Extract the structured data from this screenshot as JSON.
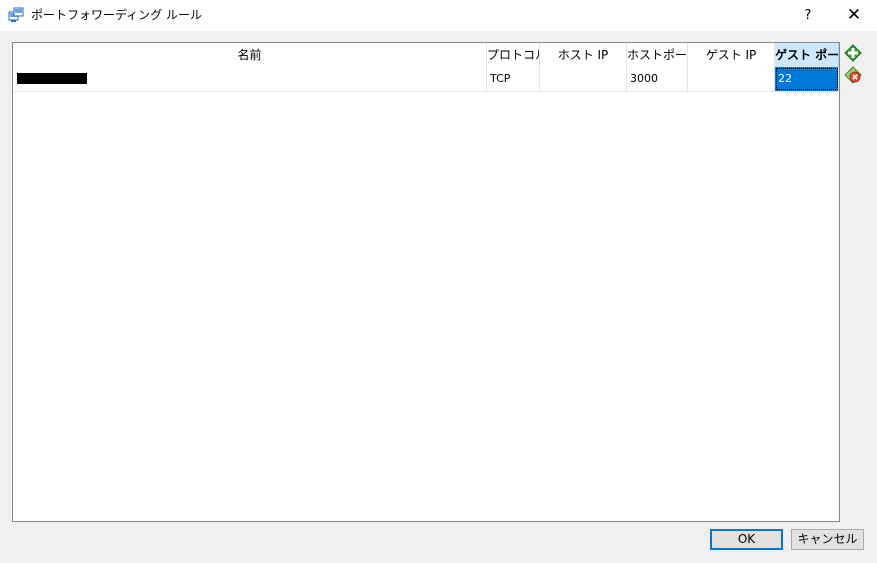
{
  "window": {
    "title": "ポートフォワーディング ルール",
    "help_label": "?",
    "close_label": "✕"
  },
  "table": {
    "columns": [
      "名前",
      "プロトコル",
      "ホスト IP",
      "ホストポート",
      "ゲスト IP",
      "ゲスト ポート"
    ],
    "active_column": "ゲスト ポート",
    "rows": [
      {
        "name": "",
        "protocol": "TCP",
        "host_ip": "",
        "host_port": "3000",
        "guest_ip": "",
        "guest_port": "22"
      }
    ]
  },
  "side_buttons": {
    "add": "add-rule-icon",
    "remove": "remove-rule-icon"
  },
  "buttons": {
    "ok": "OK",
    "cancel": "キャンセル"
  },
  "colors": {
    "selection": "#0078d7",
    "header_active": "#cce8ff",
    "add_icon": "#3aa335",
    "remove_icon": "#e04a2a"
  }
}
